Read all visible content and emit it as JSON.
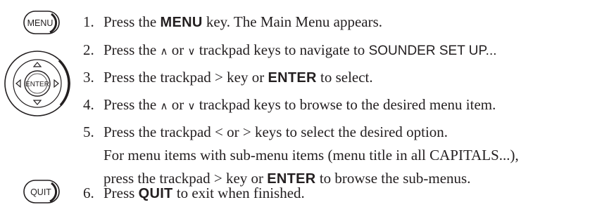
{
  "icons": {
    "menu_key": {
      "label": "MENU"
    },
    "trackpad": {
      "label": "ENTER"
    },
    "quit_key": {
      "label": "QUIT"
    }
  },
  "steps": [
    {
      "num": "1.",
      "a": "Press the ",
      "b": "MENU",
      "c": " key. The Main Menu appears."
    },
    {
      "num": "2.",
      "a": "Press the ",
      "b": "∧",
      "c": " or ",
      "d": "∨",
      "e": " trackpad keys to navigate to ",
      "f": "SOUNDER SET UP..."
    },
    {
      "num": "3.",
      "a": "Press the trackpad > key or ",
      "b": "ENTER",
      "c": " to select."
    },
    {
      "num": "4.",
      "a": "Press the ",
      "b": "∧",
      "c": " or ",
      "d": "∨",
      "e": " trackpad keys to browse to the desired menu item."
    },
    {
      "num": "5.",
      "line1": "Press the trackpad < or > keys to select the desired option.",
      "line2": "For menu items with sub-menu items (menu title in all CAPITALS...),",
      "line3a": "press the trackpad > key or ",
      "line3b": "ENTER",
      "line3c": " to browse the sub-menus."
    },
    {
      "num": "6.",
      "a": "Press ",
      "b": "QUIT",
      "c": " to exit when finished."
    }
  ]
}
